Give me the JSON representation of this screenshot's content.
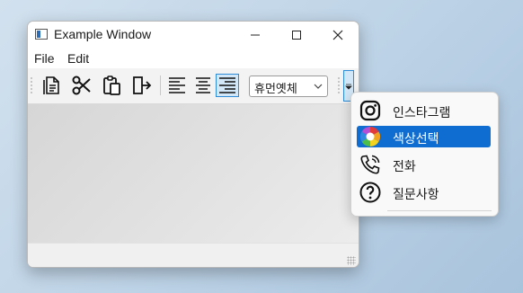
{
  "window": {
    "title": "Example Window",
    "menu": [
      "File",
      "Edit"
    ]
  },
  "toolbar": {
    "buttons": [
      {
        "icon": "new-document-icon"
      },
      {
        "icon": "cut-icon"
      },
      {
        "icon": "paste-icon"
      },
      {
        "icon": "exit-icon"
      },
      {
        "icon": "align-left-icon"
      },
      {
        "icon": "align-center-icon"
      },
      {
        "icon": "align-justify-icon",
        "active": true
      }
    ],
    "font_combo": {
      "value": "휴먼옛체"
    }
  },
  "popup_menu": {
    "items": [
      {
        "label": "인스타그램",
        "icon": "instagram-icon"
      },
      {
        "label": "색상선택",
        "icon": "color-wheel-icon",
        "selected": true
      },
      {
        "label": "전화",
        "icon": "phone-icon"
      },
      {
        "label": "질문사항",
        "icon": "question-icon"
      }
    ]
  },
  "colors": {
    "accent": "#0f6cd1",
    "active_button_bg": "#d2e8f8",
    "active_button_border": "#2f8bd6"
  }
}
